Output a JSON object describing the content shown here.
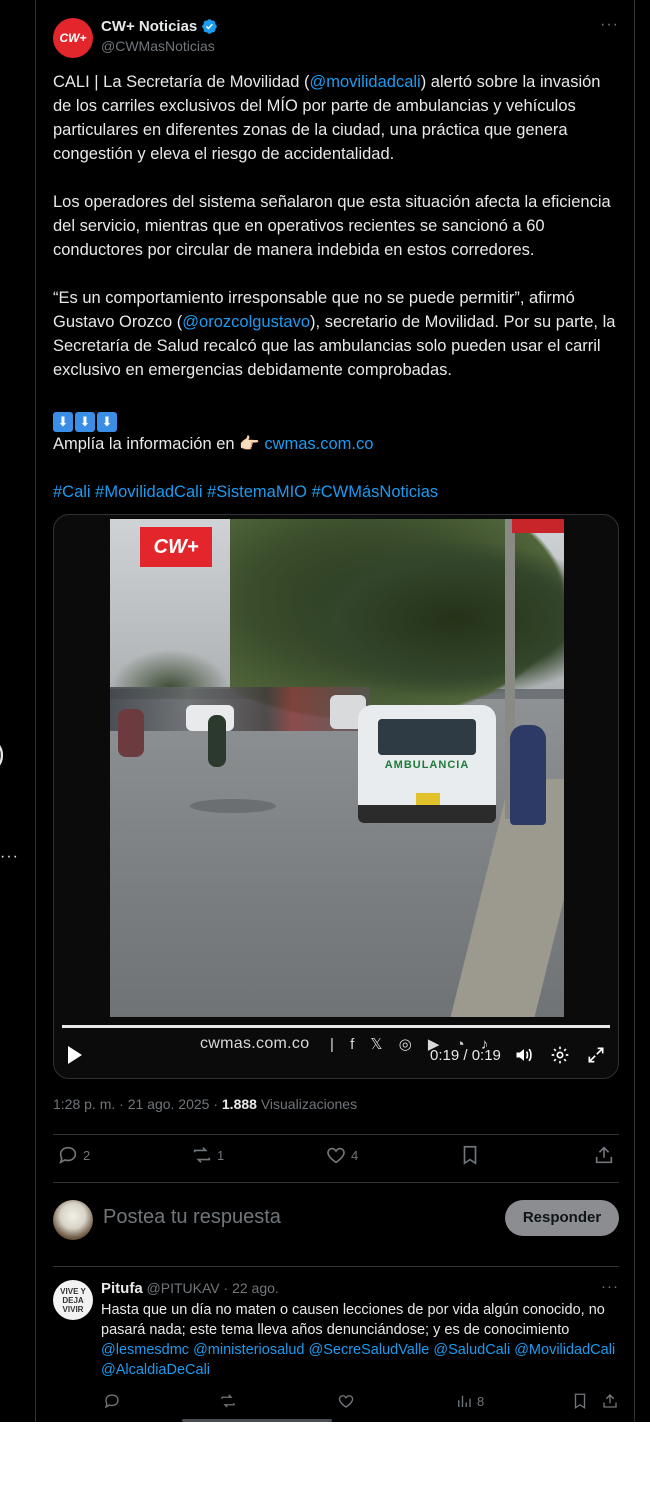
{
  "tweet": {
    "author_name": "CW+ Noticias",
    "author_handle": "@CWMasNoticias",
    "avatar_text": "CW+",
    "more_label": "···",
    "paragraphs": {
      "p1_a": "CALI | La Secretaría de Movilidad (",
      "p1_mention": "@movilidadcali",
      "p1_b": ") alertó sobre la invasión de los carriles exclusivos del MÍO por parte de ambulancias y vehículos particulares en diferentes zonas de la ciudad, una práctica que genera congestión y eleva el riesgo de accidentalidad.",
      "p2": "Los operadores del sistema señalaron que esta situación afecta la eficiencia del servicio, mientras que en operativos recientes se sancionó a 60 conductores por circular de manera indebida en estos corredores.",
      "p3_a": "“Es un comportamiento irresponsable que no se puede permitir”, afirmó Gustavo Orozco (",
      "p3_mention": "@orozcolgustavo",
      "p3_b": "), secretario de Movilidad. Por su parte, la Secretaría de Salud recalcó que las ambulancias solo pueden usar el carril exclusivo en emergencias debidamente comprobadas.",
      "arrows": [
        "⬇",
        "⬇",
        "⬇"
      ],
      "more_info": "Amplía la información en 👉🏻 ",
      "more_info_link": "cwmas.com.co",
      "hashtags": "#Cali #MovilidadCali #SistemaMIO #CWMásNoticias"
    },
    "video": {
      "watermark": "CW+",
      "site": "cwmas.com.co",
      "social": "| f 𝕏 ◎ ▶ ◔ ♪",
      "time": "0:19 / 0:19",
      "progress": 1.0
    },
    "meta": {
      "time_date": "1:28 p. m. · 21 ago. 2025 · ",
      "views_count": "1.888",
      "views_label": " Visualizaciones"
    },
    "actions": {
      "replies": "2",
      "reposts": "1",
      "likes": "4"
    }
  },
  "reply_box": {
    "placeholder": "Postea tu respuesta",
    "button": "Responder"
  },
  "comment": {
    "avatar_text": "VIVE Y DEJA VIVIR",
    "name": "Pitufa",
    "handle_date": " @PITUKAV · 22 ago.",
    "text_a": "Hasta que un día no maten o causen lecciones de por vida algún conocido, no pasará nada; este tema lleva años denunciándose; y es de conocimiento ",
    "mentions": "@lesmesdmc @ministeriosalud @SecreSaludValle @SaludCali @MovilidadCali @AlcaldiaDeCali",
    "views": "8",
    "more_label": "···"
  },
  "edge": {
    "paren": ")",
    "dots": "···"
  },
  "colors": {
    "background": "#000000",
    "text": "#e7e9ea",
    "muted": "#71767b",
    "link": "#1d9bf0",
    "brand": "#e3262b"
  }
}
